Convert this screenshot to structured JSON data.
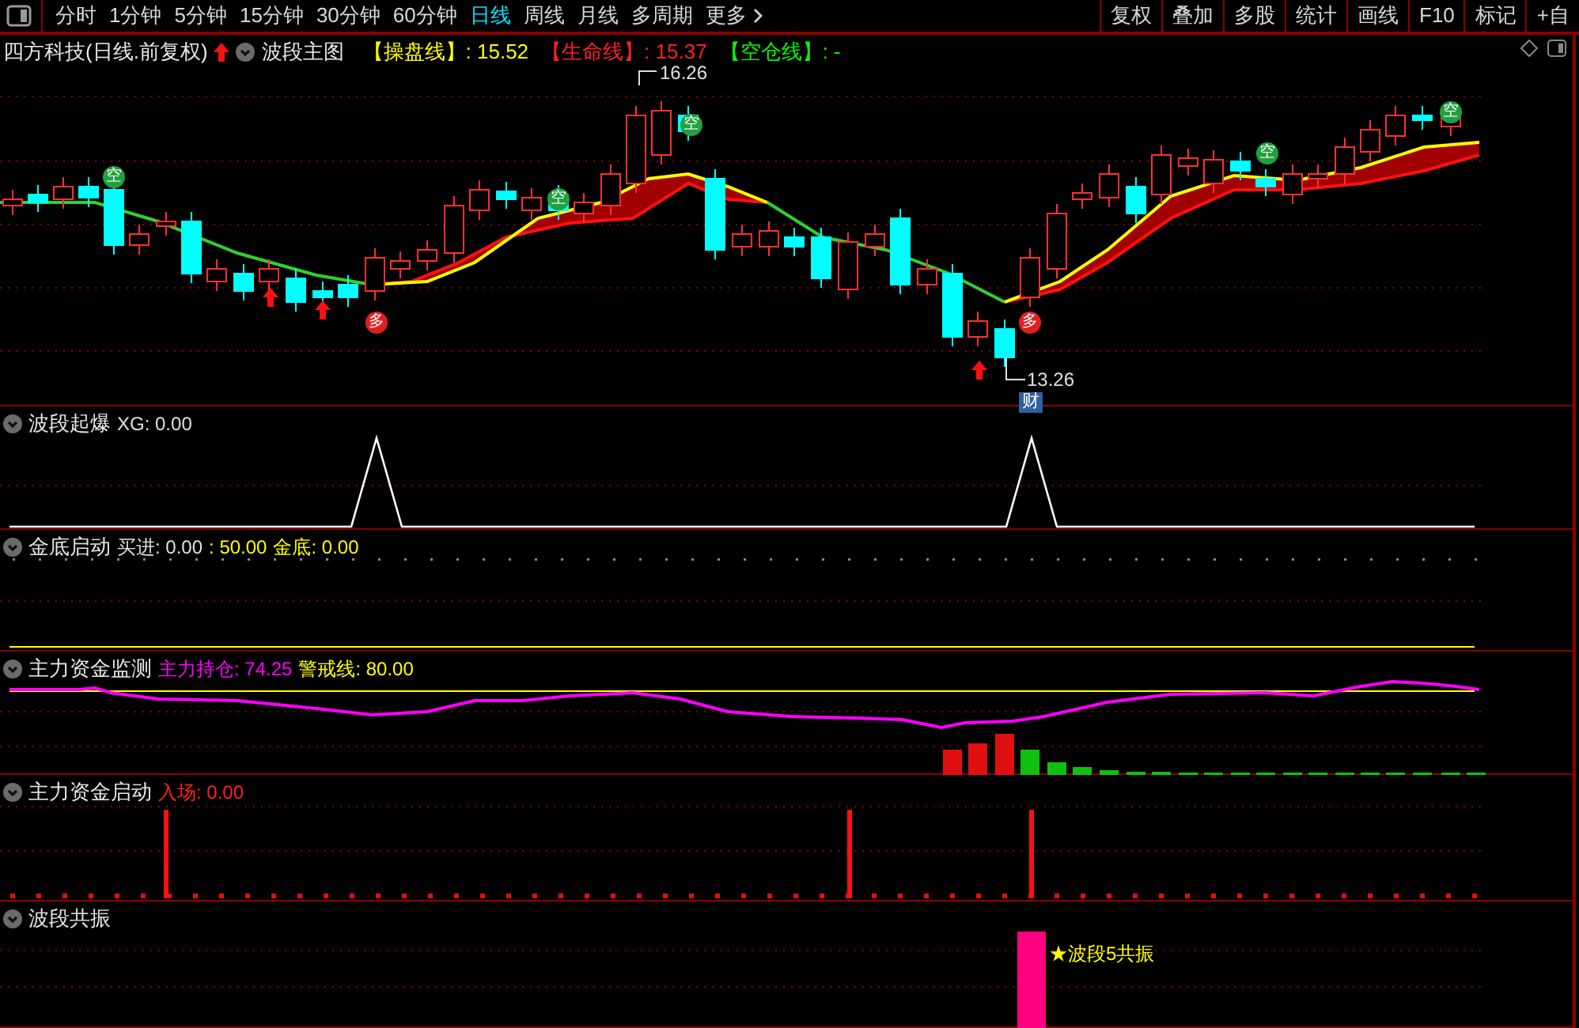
{
  "toolbar": {
    "periods": [
      {
        "label": "分时",
        "selected": false
      },
      {
        "label": "1分钟",
        "selected": false
      },
      {
        "label": "5分钟",
        "selected": false
      },
      {
        "label": "15分钟",
        "selected": false
      },
      {
        "label": "30分钟",
        "selected": false
      },
      {
        "label": "60分钟",
        "selected": false
      },
      {
        "label": "日线",
        "selected": true
      },
      {
        "label": "周线",
        "selected": false
      },
      {
        "label": "月线",
        "selected": false
      },
      {
        "label": "多周期",
        "selected": false
      },
      {
        "label": "更多",
        "selected": false
      }
    ],
    "tools": [
      "复权",
      "叠加",
      "多股",
      "统计",
      "画线",
      "F10",
      "标记",
      "+自"
    ]
  },
  "main_panel": {
    "stock": "四方科技(日线.前复权)",
    "indicator": "波段主图",
    "values": [
      {
        "label": "【操盘线】",
        "value": ": 15.52",
        "color": "#ffff00"
      },
      {
        "label": "【生命线】",
        "value": ": 15.37",
        "color": "#ff2020"
      },
      {
        "label": "【空仓线】",
        "value": ": -",
        "color": "#00ff00"
      }
    ],
    "high_label": "16.26",
    "low_label": "13.26",
    "finance_badge": "财",
    "sell_marks": [
      "空",
      "空",
      "空",
      "空",
      "空"
    ],
    "buy_marks": [
      "多",
      "多"
    ]
  },
  "panels": [
    {
      "kind": "spike",
      "title": "波段起爆",
      "values": [
        {
          "text": "XG: 0.00",
          "color": "#e0e0e0"
        }
      ]
    },
    {
      "kind": "dots",
      "title": "金底启动",
      "values": [
        {
          "text": "买进: 0.00",
          "color": "#e0e0e0"
        },
        {
          "text": ": 50.00",
          "color": "#ffff00"
        },
        {
          "text": "金底: 0.00",
          "color": "#ffff00"
        }
      ]
    },
    {
      "kind": "flow",
      "title": "主力资金监测",
      "values": [
        {
          "text": "主力持仓: 74.25",
          "color": "#ff00ff"
        },
        {
          "text": "警戒线: 80.00",
          "color": "#ffff00"
        }
      ]
    },
    {
      "kind": "bars",
      "title": "主力资金启动",
      "values": [
        {
          "text": "入场: 0.00",
          "color": "#ff2020"
        }
      ]
    },
    {
      "kind": "signal",
      "title": "波段共振",
      "signal": "★波段5共振"
    }
  ]
}
